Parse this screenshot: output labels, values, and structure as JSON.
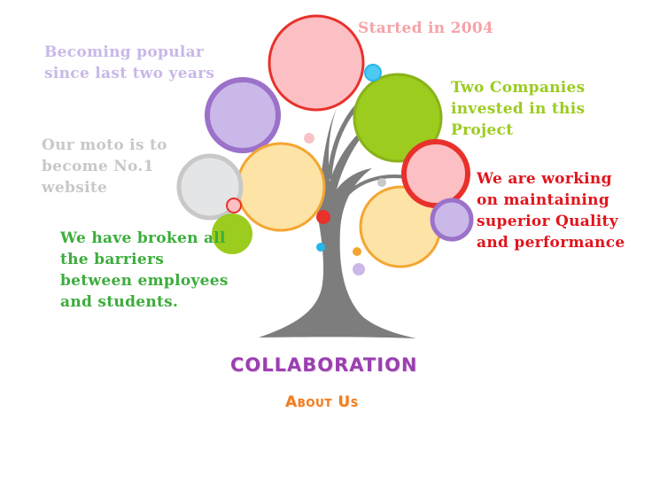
{
  "captions": {
    "started": [
      "Started in 2004"
    ],
    "popular": [
      "Becoming popular",
      "since last two years"
    ],
    "companies": [
      "Two Companies",
      "invested in this",
      "Project"
    ],
    "moto": [
      "Our moto is to",
      "become No.1",
      "website"
    ],
    "quality": [
      "We are working",
      "on maintaining",
      "superior Quality",
      "and performance"
    ],
    "barriers": [
      "We have broken all",
      "the barriers",
      "between employees",
      "and students."
    ]
  },
  "headings": {
    "collaboration": "COLLABORATION",
    "about": "About Us"
  },
  "colors": {
    "trunk": "#7d7d7d",
    "pink": "#f4a3a8",
    "red": "#e8312b",
    "lavender": "#c9b8e8",
    "purple": "#9b71c9",
    "green": "#9bcc1e",
    "yellow": "#fbd98f",
    "orange": "#f3a632",
    "grey": "#c8c8c8",
    "blue": "#27b6ea"
  },
  "icons": [
    "tree-illustration"
  ]
}
